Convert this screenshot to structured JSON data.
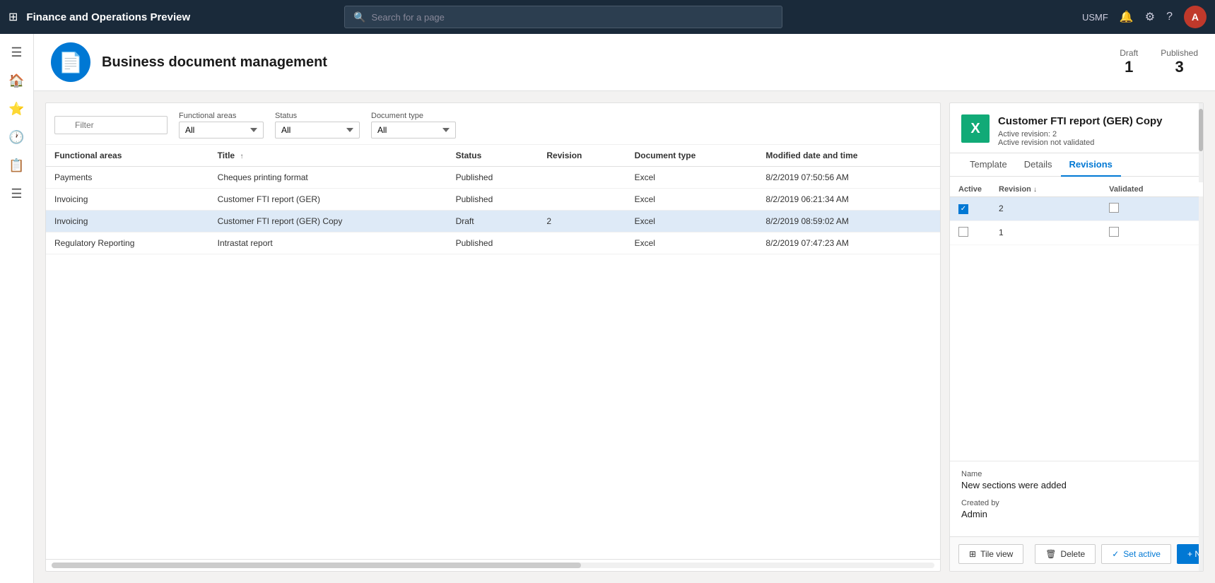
{
  "app": {
    "title": "Finance and Operations Preview",
    "search_placeholder": "Search for a page",
    "user": "USMF",
    "avatar_letter": "A"
  },
  "page": {
    "title": "Business document management",
    "icon": "📄",
    "stats": {
      "draft_label": "Draft",
      "draft_value": "1",
      "published_label": "Published",
      "published_value": "3"
    }
  },
  "filters": {
    "filter_placeholder": "Filter",
    "functional_areas_label": "Functional areas",
    "functional_areas_value": "All",
    "status_label": "Status",
    "status_value": "All",
    "document_type_label": "Document type",
    "document_type_value": "All"
  },
  "table": {
    "columns": [
      "Functional areas",
      "Title ↑",
      "Status",
      "Revision",
      "Document type",
      "Modified date and time"
    ],
    "rows": [
      {
        "functional_area": "Payments",
        "title": "Cheques printing format",
        "status": "Published",
        "revision": "",
        "document_type": "Excel",
        "modified": "8/2/2019 07:50:56 AM",
        "selected": false
      },
      {
        "functional_area": "Invoicing",
        "title": "Customer FTI report (GER)",
        "status": "Published",
        "revision": "",
        "document_type": "Excel",
        "modified": "8/2/2019 06:21:34 AM",
        "selected": false
      },
      {
        "functional_area": "Invoicing",
        "title": "Customer FTI report (GER) Copy",
        "status": "Draft",
        "revision": "2",
        "document_type": "Excel",
        "modified": "8/2/2019 08:59:02 AM",
        "selected": true
      },
      {
        "functional_area": "Regulatory Reporting",
        "title": "Intrastat report",
        "status": "Published",
        "revision": "",
        "document_type": "Excel",
        "modified": "8/2/2019 07:47:23 AM",
        "selected": false
      }
    ]
  },
  "detail": {
    "title": "Customer FTI report (GER) Copy",
    "subtitle": "Active revision: 2",
    "subtitle2": "Active revision not validated",
    "tabs": [
      "Template",
      "Details",
      "Revisions"
    ],
    "active_tab": "Revisions",
    "revisions_columns": [
      "Active",
      "Revision ↓",
      "Validated"
    ],
    "revisions": [
      {
        "active": true,
        "revision": "2",
        "validated": false,
        "selected": true
      },
      {
        "active": false,
        "revision": "1",
        "validated": false,
        "selected": false
      }
    ],
    "name_label": "Name",
    "name_value": "New sections were added",
    "created_by_label": "Created by",
    "created_by_value": "Admin"
  },
  "actions": {
    "tile_view_label": "Tile view",
    "delete_label": "Delete",
    "set_active_label": "Set active",
    "new_label": "+ New"
  },
  "sidebar": {
    "icons": [
      "☰",
      "🏠",
      "⭐",
      "🕐",
      "📋",
      "☰"
    ]
  }
}
